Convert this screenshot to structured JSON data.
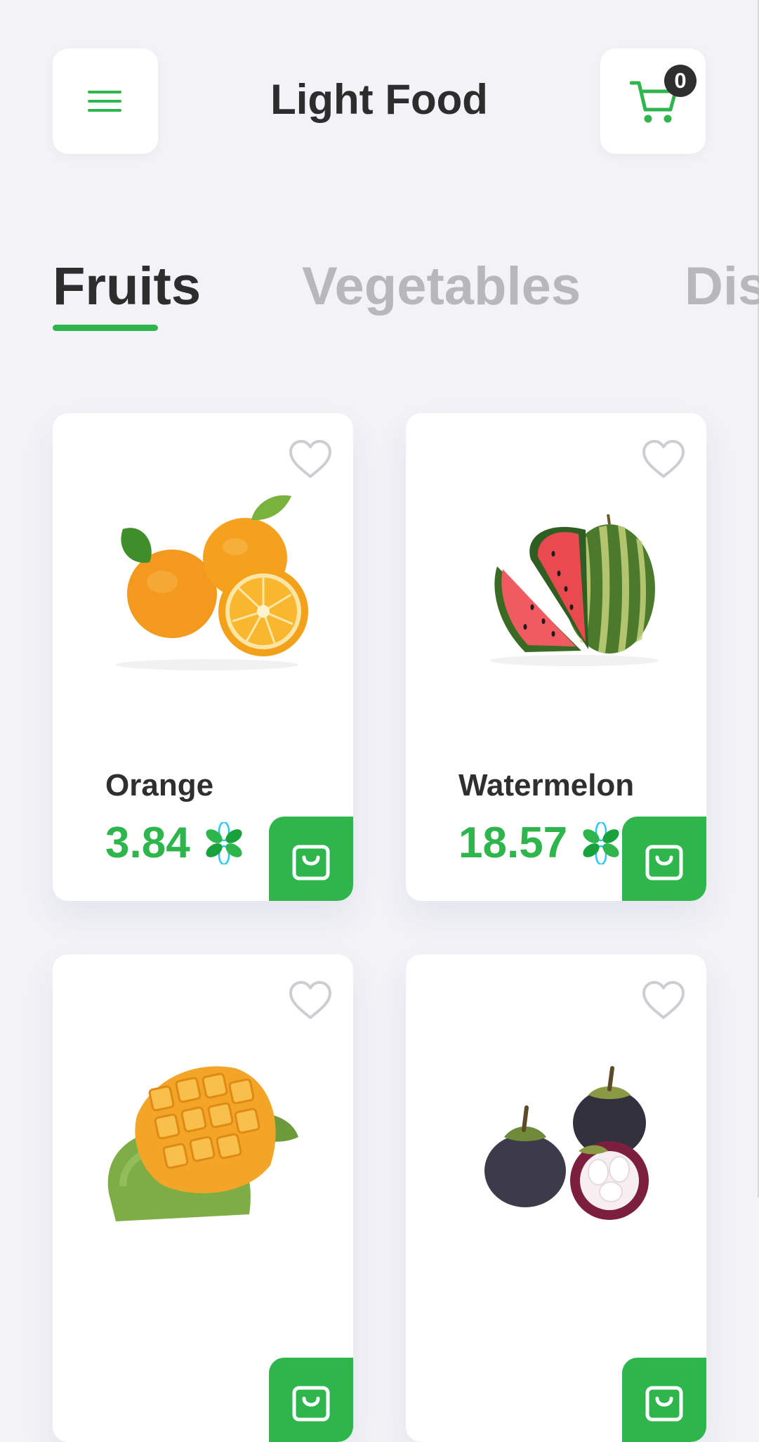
{
  "header": {
    "title": "Light Food",
    "menu_icon": "menu-icon",
    "cart_icon": "cart-icon",
    "cart_count": "0",
    "accent_color": "#2eb64d",
    "text_color": "#2d2d2d"
  },
  "tabs": [
    {
      "label": "Fruits",
      "active": true
    },
    {
      "label": "Vegetables",
      "active": false
    },
    {
      "label": "Dis",
      "active": false
    }
  ],
  "products": [
    {
      "name": "Orange",
      "price": "3.84",
      "image": "orange-image",
      "favorite_icon": "heart-icon",
      "add_icon": "shopping-bag-icon"
    },
    {
      "name": "Watermelon",
      "price": "18.57",
      "image": "watermelon-image",
      "favorite_icon": "heart-icon",
      "add_icon": "shopping-bag-icon"
    },
    {
      "name": "",
      "price": "",
      "image": "mango-image",
      "favorite_icon": "heart-icon",
      "add_icon": "shopping-bag-icon"
    },
    {
      "name": "",
      "price": "",
      "image": "mangosteen-image",
      "favorite_icon": "heart-icon",
      "add_icon": "shopping-bag-icon"
    }
  ],
  "currency_icon": "leaf-currency-icon"
}
